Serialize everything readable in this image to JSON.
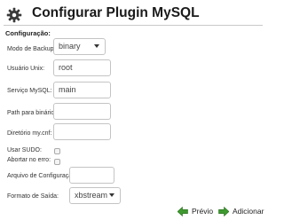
{
  "header": {
    "title": "Configurar Plugin MySQL",
    "icon": "gear-icon"
  },
  "form": {
    "section_title": "Configuração:",
    "backup_mode": {
      "label": "Modo de Backup:",
      "value": "binary"
    },
    "unix_user": {
      "label": "Usuário Unix:",
      "value": "root"
    },
    "mysql_service": {
      "label": "Serviço MySQL:",
      "value": "main"
    },
    "binaries_path": {
      "label": "Path para binários:",
      "value": ""
    },
    "mycnf_dir": {
      "label": "Diretório my.cnf:",
      "value": ""
    },
    "use_sudo": {
      "label": "Usar SUDO:",
      "checked": false
    },
    "abort_on_error": {
      "label": "Abortar no erro:",
      "checked": false
    },
    "config_file": {
      "label": "Arquivo de Configuração:",
      "value": ""
    },
    "output_format": {
      "label": "Formato de Saída:",
      "value": "xbstream"
    }
  },
  "footer": {
    "previous_label": "Prévio",
    "add_label": "Adicionar"
  },
  "colors": {
    "accent_green": "#3f9a2f"
  }
}
